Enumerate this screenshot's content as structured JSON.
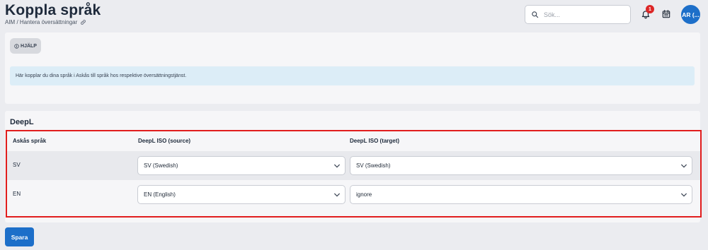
{
  "header": {
    "title": "Koppla språk",
    "breadcrumb": "AIM / Hantera översättningar",
    "search_placeholder": "Sök...",
    "notification_count": "1",
    "avatar_initials": "AR (..."
  },
  "help": {
    "button_label": "HJÄLP",
    "info_text": "Här kopplar du dina språk i Askås till språk hos respektive översättningstjänst."
  },
  "deepl": {
    "title": "DeepL",
    "columns": [
      "Askås språk",
      "DeepL ISO (source)",
      "DeepL ISO (target)"
    ],
    "rows": [
      {
        "lang": "SV",
        "source": "SV (Swedish)",
        "target": "SV (Swedish)"
      },
      {
        "lang": "EN",
        "source": "EN (English)",
        "target": "ignore"
      }
    ]
  },
  "actions": {
    "save_label": "Spara"
  },
  "colors": {
    "primary": "#1d6fc9",
    "badge": "#dc2626",
    "highlight_border": "#e11d1d",
    "info_bg": "#dcedf7"
  }
}
